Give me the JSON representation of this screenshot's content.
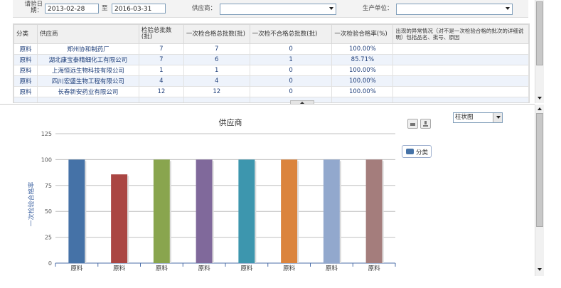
{
  "filters": {
    "date_label": "请验日期：",
    "date_from": "2013-02-28",
    "date_sep": "至",
    "date_to": "2016-03-31",
    "supplier_label": "供应商：",
    "supplier_value": "",
    "producer_label": "生产单位：",
    "producer_value": ""
  },
  "table": {
    "columns": [
      "分类",
      "供应商",
      "检验总批数(批)",
      "一次检合格总批数(批)",
      "一次检不合格总批数(批)",
      "一次检验合格率(%)",
      "出现的异常情况（对不是一次检验合格的批次的详细说明）包括品名、批号、原因"
    ],
    "rows": [
      [
        "原料",
        "郑州协和制药厂",
        "7",
        "7",
        "0",
        "100.00%",
        ""
      ],
      [
        "原料",
        "湖北康宝泰精细化工有限公司",
        "7",
        "6",
        "1",
        "85.71%",
        ""
      ],
      [
        "原料",
        "上海恒远生物科技有限公司",
        "1",
        "1",
        "0",
        "100.00%",
        ""
      ],
      [
        "原料",
        "四川宏盛生物工程有限公司",
        "4",
        "4",
        "0",
        "100.00%",
        ""
      ],
      [
        "原料",
        "长春新安药业有限公司",
        "12",
        "12",
        "0",
        "100.00%",
        ""
      ],
      [
        "",
        "",
        "",
        "",
        "",
        "",
        ""
      ]
    ]
  },
  "chart_type_select": "柱状图",
  "chart_data": {
    "type": "bar",
    "title": "供应商",
    "ylabel": "一次检验合格率",
    "xlabel": "",
    "categories": [
      "原料",
      "原料",
      "原料",
      "原料",
      "原料",
      "原料",
      "原料",
      "原料"
    ],
    "values": [
      100,
      85.71,
      100,
      100,
      100,
      100,
      100,
      100
    ],
    "colors": [
      "#4572a7",
      "#aa4643",
      "#89a54e",
      "#80699b",
      "#3d96ae",
      "#db843d",
      "#92a8cd",
      "#a47d7c"
    ],
    "ylim": [
      0,
      125
    ],
    "yticks": [
      0,
      25,
      50,
      75,
      100,
      125
    ],
    "legend": "分类",
    "legend_position": "top-right",
    "grid": true
  }
}
